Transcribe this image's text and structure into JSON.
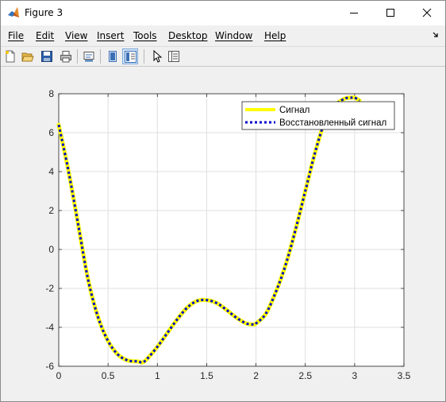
{
  "window": {
    "title": "Figure 3",
    "icon": "matlab-icon"
  },
  "menu": {
    "items": [
      "File",
      "Edit",
      "View",
      "Insert",
      "Tools",
      "Desktop",
      "Window",
      "Help"
    ]
  },
  "toolbar": {
    "buttons": [
      "new-figure-icon",
      "open-file-icon",
      "save-icon",
      "print-icon",
      "link-plot-icon",
      "hide-plot-tools-icon",
      "show-plot-tools-icon",
      "edit-plot-pointer-icon",
      "property-inspector-icon"
    ],
    "active_button": "show-plot-tools-icon"
  },
  "chart_data": {
    "type": "line",
    "title": "",
    "xlabel": "",
    "ylabel": "",
    "xlim": [
      0,
      3.5
    ],
    "ylim": [
      -6,
      8
    ],
    "xticks": [
      "0",
      "0.5",
      "1",
      "1.5",
      "2",
      "2.5",
      "3",
      "3.5"
    ],
    "yticks": [
      "-6",
      "-4",
      "-2",
      "0",
      "2",
      "4",
      "6",
      "8"
    ],
    "grid": true,
    "legend_position": "top-right",
    "x": [
      0,
      0.1,
      0.2,
      0.3,
      0.4,
      0.5,
      0.6,
      0.7,
      0.8,
      0.85,
      0.9,
      1.0,
      1.1,
      1.2,
      1.3,
      1.4,
      1.5,
      1.6,
      1.7,
      1.8,
      1.9,
      1.97,
      2.0,
      2.1,
      2.2,
      2.3,
      2.4,
      2.5,
      2.6,
      2.7,
      2.8,
      2.9,
      2.97,
      3.0,
      3.05
    ],
    "series": [
      {
        "name": "Сигнал",
        "color": "#ffff00",
        "style": "solid",
        "values": [
          6.4,
          4.0,
          1.2,
          -1.6,
          -3.5,
          -4.7,
          -5.4,
          -5.7,
          -5.75,
          -5.8,
          -5.6,
          -5.0,
          -4.3,
          -3.6,
          -3.0,
          -2.65,
          -2.6,
          -2.75,
          -3.1,
          -3.5,
          -3.8,
          -3.85,
          -3.8,
          -3.3,
          -2.2,
          -0.8,
          1.0,
          3.0,
          5.0,
          6.6,
          7.4,
          7.75,
          7.8,
          7.8,
          7.65
        ]
      },
      {
        "name": "Восстановленный сигнал",
        "color": "#0000cc",
        "style": "dotted",
        "values": [
          6.4,
          4.0,
          1.2,
          -1.6,
          -3.5,
          -4.7,
          -5.4,
          -5.7,
          -5.75,
          -5.8,
          -5.6,
          -5.0,
          -4.3,
          -3.6,
          -3.0,
          -2.65,
          -2.6,
          -2.75,
          -3.1,
          -3.5,
          -3.8,
          -3.85,
          -3.8,
          -3.3,
          -2.2,
          -0.8,
          1.0,
          3.0,
          5.0,
          6.6,
          7.4,
          7.75,
          7.8,
          7.8,
          7.65
        ]
      }
    ]
  }
}
